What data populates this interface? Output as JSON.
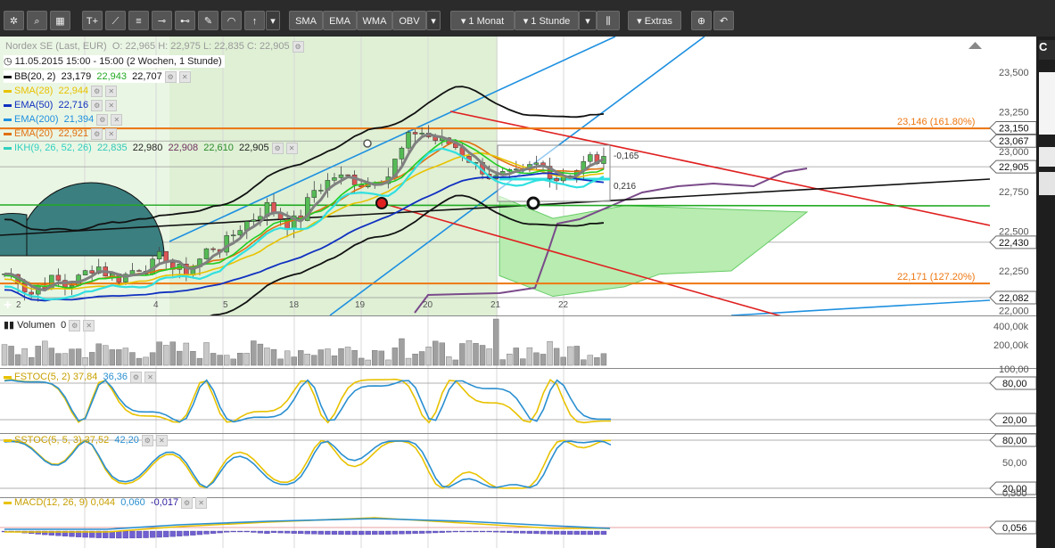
{
  "toolbar": {
    "icons": [
      "settings-icon",
      "search-icon",
      "grid-icon"
    ],
    "drawing_tools": [
      "T+",
      "line-icon",
      "fib-icon",
      "hline-icon",
      "channel-icon",
      "pen-icon",
      "arc-icon",
      "arrow-up-icon"
    ],
    "indicators": [
      "SMA",
      "EMA",
      "WMA",
      "OBV"
    ],
    "period": "1 Monat",
    "interval": "1 Stunde",
    "extras": "Extras"
  },
  "legend": {
    "instrument": "Nordex SE (Last, EUR)",
    "ohlc": "O: 22,965  H: 22,975  L: 22,835  C: 22,905",
    "timestamp": "11.05.2015 15:00 - 15:00 (2 Wochen, 1 Stunde)",
    "lines": [
      {
        "name": "BB(20, 2)",
        "vals": [
          "23,179",
          "22,943",
          "22,707"
        ],
        "color": "#111111"
      },
      {
        "name": "SMA(28)",
        "vals": [
          "22,944"
        ],
        "color": "#e8c200"
      },
      {
        "name": "EMA(50)",
        "vals": [
          "22,716"
        ],
        "color": "#1030c0"
      },
      {
        "name": "EMA(200)",
        "vals": [
          "21,394"
        ],
        "color": "#1e90e0"
      },
      {
        "name": "EMA(20)",
        "vals": [
          "22,921"
        ],
        "color": "#e07010"
      },
      {
        "name": "IKH(9, 26, 52, 26)",
        "vals": [
          "22,835",
          "22,980",
          "22,908",
          "22,610",
          "22,905"
        ],
        "color": "#30d0c0"
      }
    ]
  },
  "price_axis": {
    "ticks": [
      "23,500",
      "23,250",
      "23,000",
      "22,750",
      "22,500",
      "22,250",
      "22,000"
    ],
    "boxes": [
      "23,150",
      "23,067",
      "22,905",
      "22,430",
      "22,082"
    ],
    "fib_upper": "23,146 (161.80%)",
    "fib_lower": "22,171 (127.20%)",
    "annot_a": "-0,165",
    "annot_b": "0,216"
  },
  "date_labels": [
    "2",
    "4",
    "5",
    "18",
    "19",
    "20",
    "21",
    "22"
  ],
  "volume": {
    "title": "Volumen",
    "value": "0",
    "ticks": [
      "400,00k",
      "200,00k"
    ]
  },
  "fstoc": {
    "name": "FSTOC(5, 2)",
    "v1": "37,84",
    "v2": "36,36",
    "ticks": [
      "100,00",
      "80,00",
      "20,00"
    ]
  },
  "sstoc": {
    "name": "SSTOC(5, 5, 3)",
    "v1": "37,52",
    "v2": "42,20",
    "ticks": [
      "80,00",
      "50,00",
      "20,00"
    ]
  },
  "macd": {
    "name": "MACD(12, 26, 9)",
    "v1": "0,044",
    "v2": "0,060",
    "v3": "-0,017",
    "ticks": [
      "0,500",
      "0,056"
    ]
  },
  "colors": {
    "toolbar": "#2b2b2b",
    "bull": "#55bb55",
    "bear": "#dd5555",
    "fib": "#ee7711",
    "trend_red": "#e02020",
    "trend_blue": "#1e90e0"
  }
}
